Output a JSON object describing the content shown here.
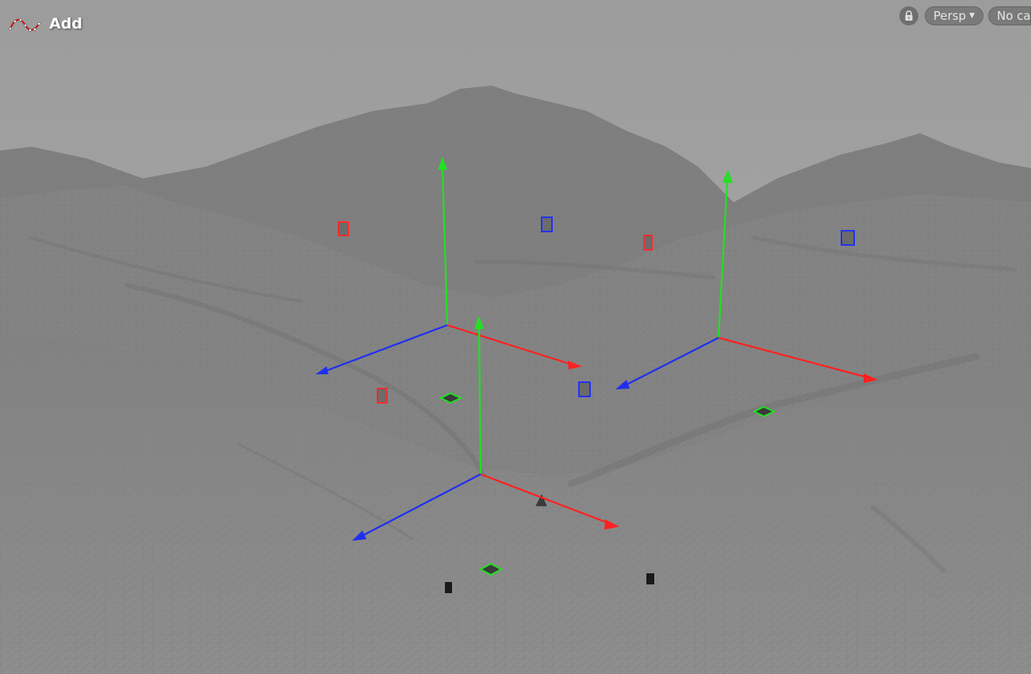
{
  "tool": {
    "label": "Add",
    "icon": "curve-tool-icon"
  },
  "viewport_controls": {
    "lock_icon": "lock-icon",
    "view_label": "Persp",
    "camera_label": "No ca"
  },
  "scene": {
    "terrain": "wireframe-heightfield-mountains",
    "handles": [
      {
        "name": "transform-handle-left",
        "axes": [
          "x",
          "y",
          "z"
        ]
      },
      {
        "name": "transform-handle-right",
        "axes": [
          "x",
          "y",
          "z"
        ]
      },
      {
        "name": "transform-handle-front",
        "axes": [
          "x",
          "y",
          "z"
        ]
      }
    ],
    "colors": {
      "x_axis": "#ff2020",
      "y_axis": "#22e022",
      "z_axis": "#1f2ff0",
      "terrain": "#878787",
      "sky": "#a3a3a3"
    }
  }
}
